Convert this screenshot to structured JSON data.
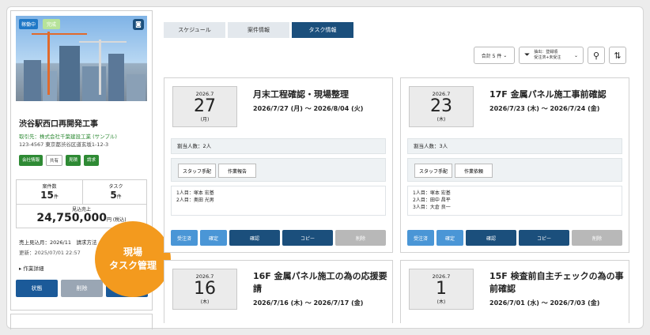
{
  "project": {
    "badge_running": "稼働中",
    "badge_new": "完成",
    "title": "渋谷駅西口再開発工事",
    "client": "取引先：株式会社千葉建設工業 (サンプル)",
    "address": "123-4567 東京都渋谷区道玄坂1-12-3",
    "tags": [
      "会社情報",
      "共有",
      "見積",
      "請求"
    ],
    "stats": {
      "cases_label": "案件数",
      "cases_value": "15",
      "cases_unit": "件",
      "tasks_label": "タスク",
      "tasks_value": "5",
      "tasks_unit": "件",
      "sales_label": "見込売上",
      "sales_value": "24,750,000",
      "sales_unit": "円 (税込)"
    },
    "meta1": "売上見込月：2026/11　請求方法",
    "meta2": "更新：2025/07/01 22:57",
    "detail": "▸ 作業詳細",
    "buttons": {
      "status": "状態",
      "delete": "削除"
    }
  },
  "bubble": {
    "line1": "現場",
    "line2": "タスク管理"
  },
  "tabs": [
    "スケジュール",
    "案件情報",
    "タスク情報"
  ],
  "toolbar": {
    "count": "合計 5 件",
    "filter_line1": "抽出：登録順",
    "filter_line2": "受注済+未受注"
  },
  "tasks": [
    {
      "ym": "2026.7",
      "day": "27",
      "wd": "(月)",
      "title": "月末工程確認・現場整理",
      "period": "2026/7/27 (月) 〜 2026/8/04 (火)",
      "assign": "割当人数：2人",
      "people": [
        "1人目：塚本 宏基",
        "2人目：奥田 光男"
      ]
    },
    {
      "ym": "2026.7",
      "day": "23",
      "wd": "(木)",
      "title": "17F 金属パネル施工事前確認",
      "period": "2026/7/23 (木) 〜 2026/7/24 (金)",
      "assign": "割当人数：3人",
      "people": [
        "1人目：塚本 宏基",
        "2人目：田中 昌平",
        "3人目：大倉 良一"
      ]
    },
    {
      "ym": "2026.7",
      "day": "16",
      "wd": "(木)",
      "title": "16F 金属パネル施工の為の応援要請",
      "period": "2026/7/16 (木) 〜 2026/7/17 (金)"
    },
    {
      "ym": "2026.7",
      "day": "1",
      "wd": "(木)",
      "title": "15F 検査前自主チェックの為の事前確認",
      "period": "2026/7/01 (水) 〜 2026/7/03 (金)"
    }
  ],
  "card_buttons": {
    "staff": "スタッフ手配",
    "report": "作業報告",
    "report2": "作業依頼",
    "ordered": "受注済",
    "fixed": "確定",
    "confirm": "確認",
    "copy": "コピー",
    "delete": "削除"
  },
  "colors": {
    "primary": "#1b4f7c",
    "light_blue": "#4a96d6",
    "green": "#2e8a34",
    "orange": "#f39a1e"
  },
  "icons": [
    "camera-icon",
    "filter-icon",
    "search-icon",
    "sort-icon"
  ]
}
